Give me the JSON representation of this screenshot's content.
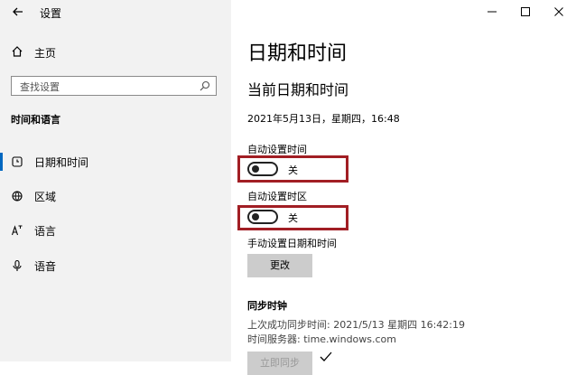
{
  "window": {
    "title": "设置"
  },
  "sidebar": {
    "home_label": "主页",
    "search_placeholder": "查找设置",
    "section_title": "时间和语言",
    "items": [
      {
        "label": "日期和时间",
        "active": true,
        "icon": "clock-icon"
      },
      {
        "label": "区域",
        "active": false,
        "icon": "globe-icon"
      },
      {
        "label": "语言",
        "active": false,
        "icon": "language-icon"
      },
      {
        "label": "语音",
        "active": false,
        "icon": "microphone-icon"
      }
    ]
  },
  "main": {
    "page_title": "日期和时间",
    "section_title": "当前日期和时间",
    "current_datetime": "2021年5月13日，星期四，16:48",
    "auto_time": {
      "label": "自动设置时间",
      "state": "关"
    },
    "auto_timezone": {
      "label": "自动设置时区",
      "state": "关"
    },
    "manual_label": "手动设置日期和时间",
    "change_button": "更改",
    "sync": {
      "title": "同步时钟",
      "last_sync": "上次成功同步时间: 2021/5/13 星期四 16:42:19",
      "server": "时间服务器: time.windows.com",
      "sync_button": "立即同步"
    }
  },
  "colors": {
    "accent": "#0067c0",
    "highlight_box": "#a11e24",
    "sidebar_bg": "#f2f2f2"
  }
}
